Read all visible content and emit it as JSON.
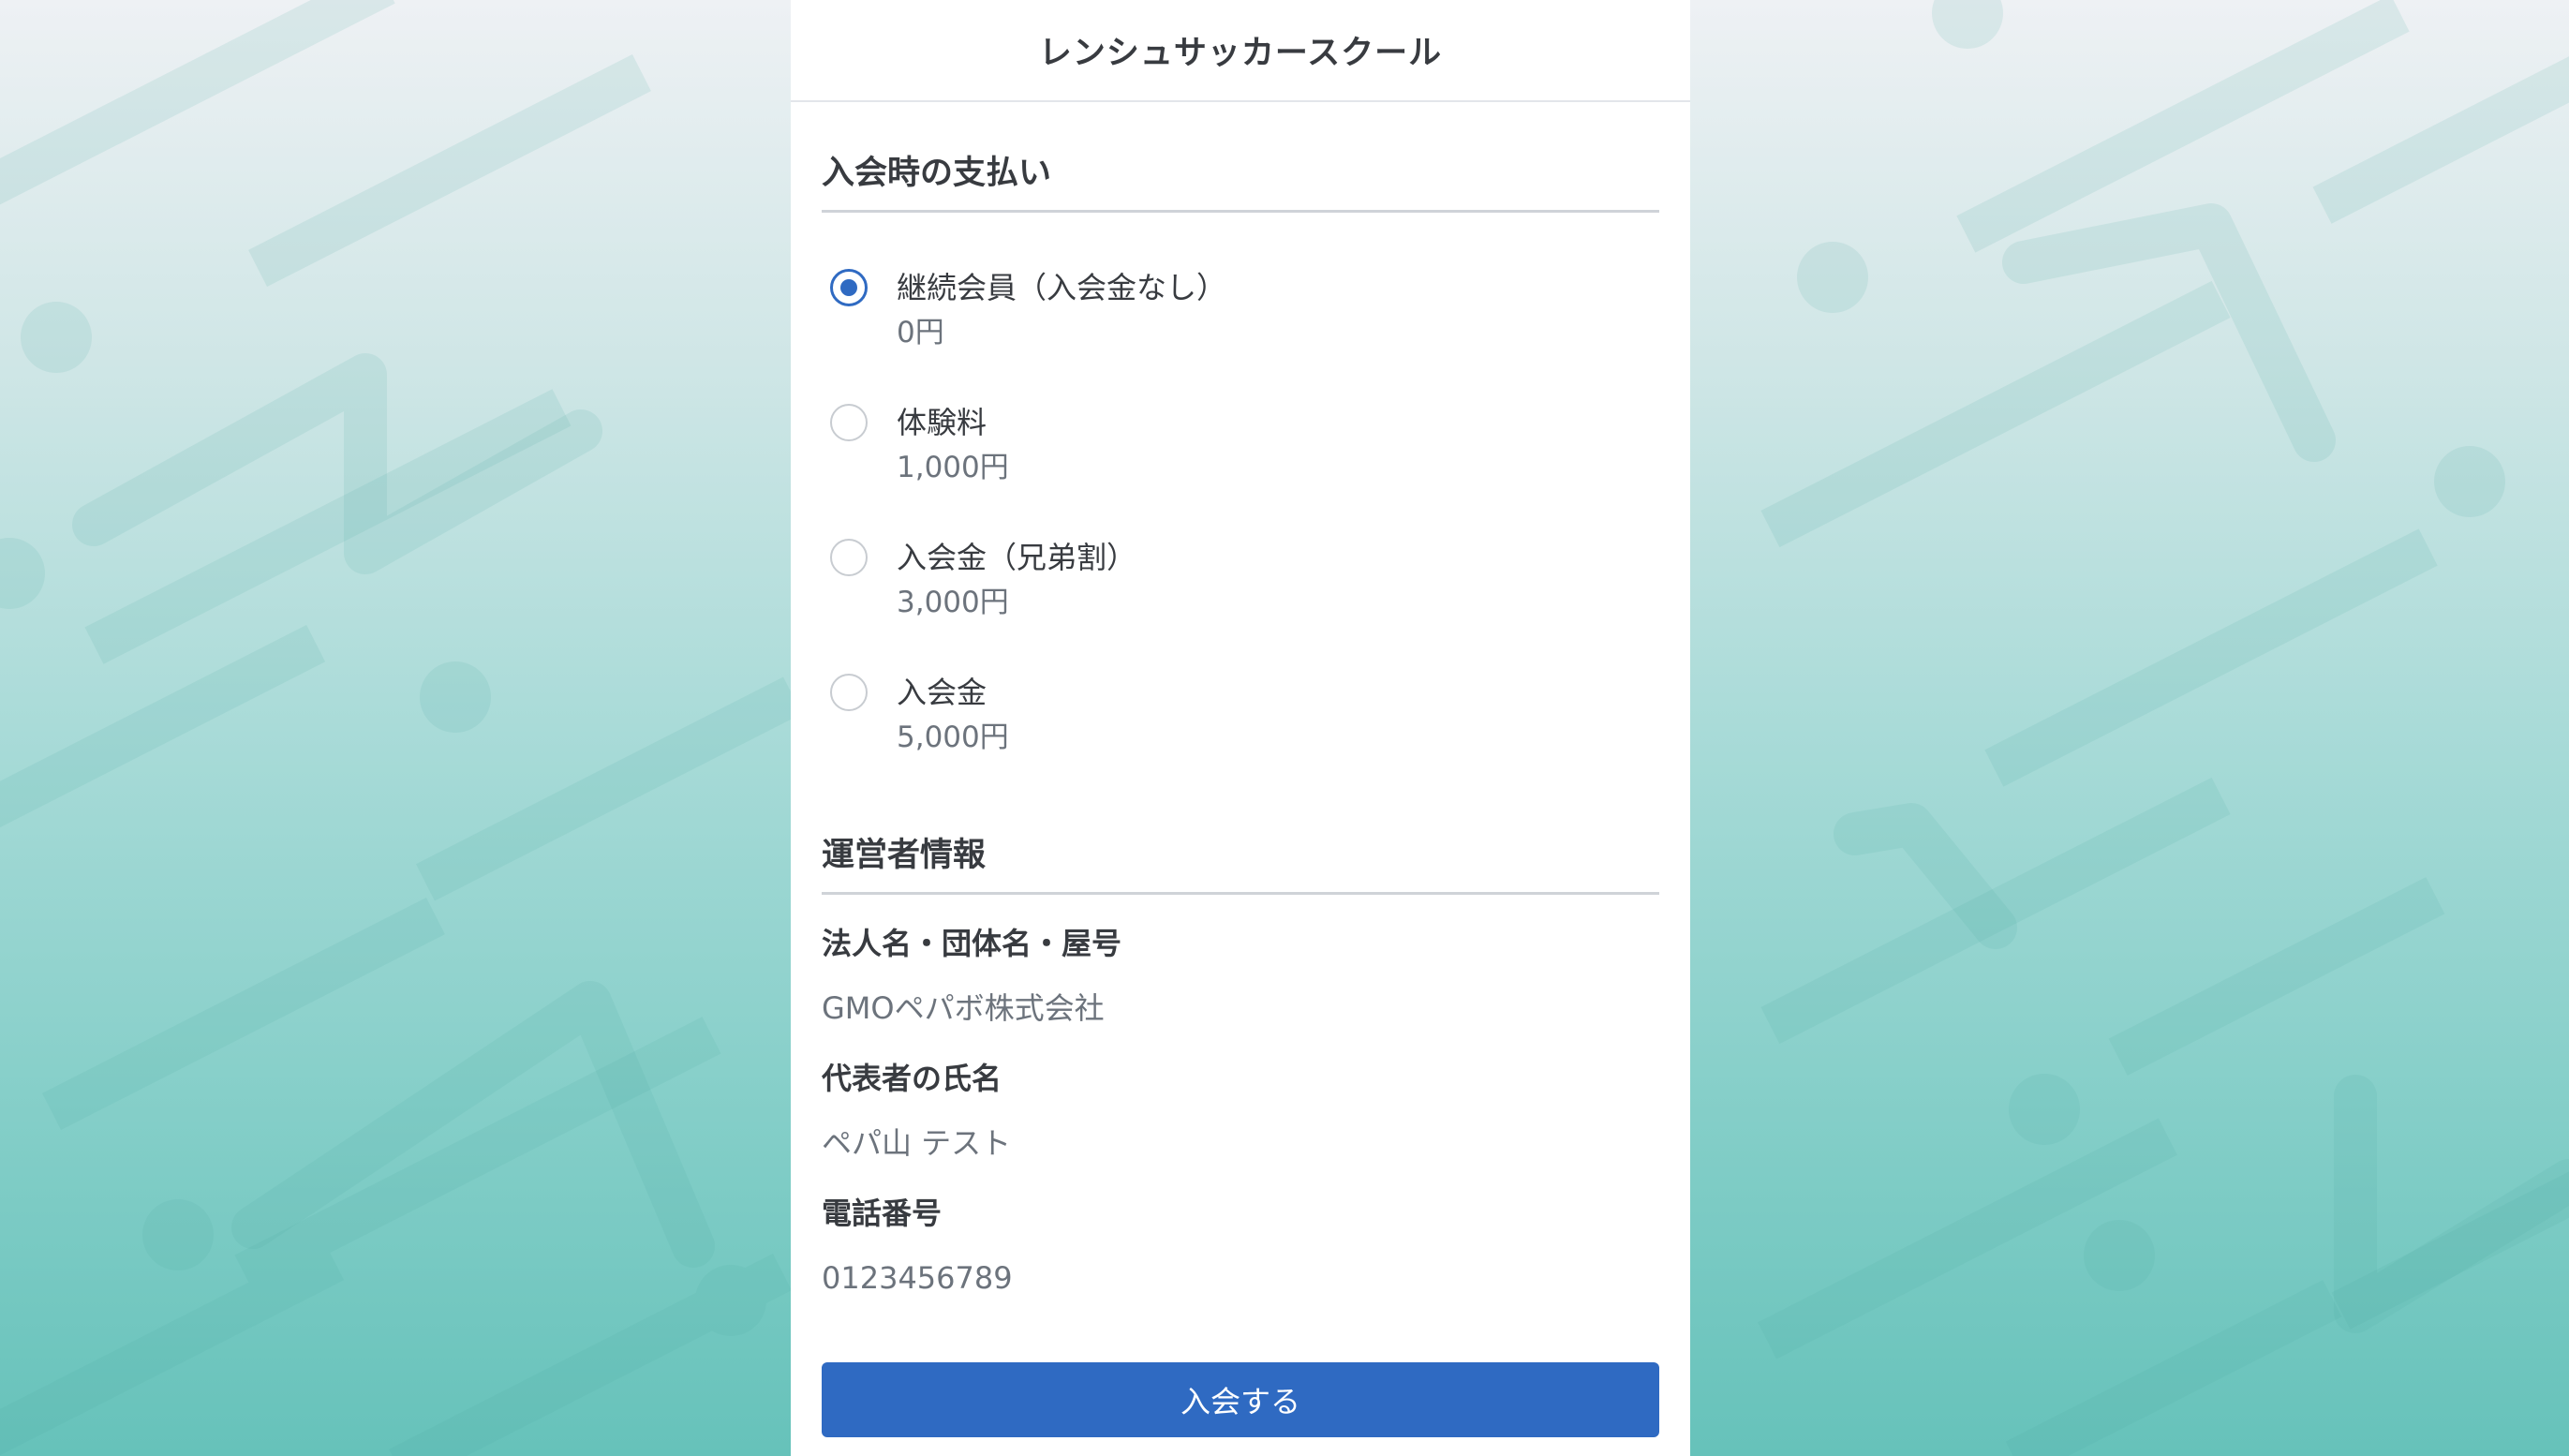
{
  "header": {
    "title": "レンシュサッカースクール"
  },
  "payment": {
    "title": "入会時の支払い",
    "options": [
      {
        "name": "継続会員（入会金なし）",
        "price": "0円",
        "selected": true
      },
      {
        "name": "体験料",
        "price": "1,000円",
        "selected": false
      },
      {
        "name": "入会金（兄弟割）",
        "price": "3,000円",
        "selected": false
      },
      {
        "name": "入会金",
        "price": "5,000円",
        "selected": false
      }
    ]
  },
  "operator": {
    "title": "運営者情報",
    "fields": [
      {
        "label": "法人名・団体名・屋号",
        "value": "GMOペパボ株式会社"
      },
      {
        "label": "代表者の氏名",
        "value": "ペパ山 テスト"
      },
      {
        "label": "電話番号",
        "value": "0123456789"
      }
    ]
  },
  "actions": {
    "join_label": "入会する"
  },
  "colors": {
    "accent": "#2f6ac2",
    "background_top": "#eef1f4",
    "background_bottom": "#66c2ba"
  }
}
